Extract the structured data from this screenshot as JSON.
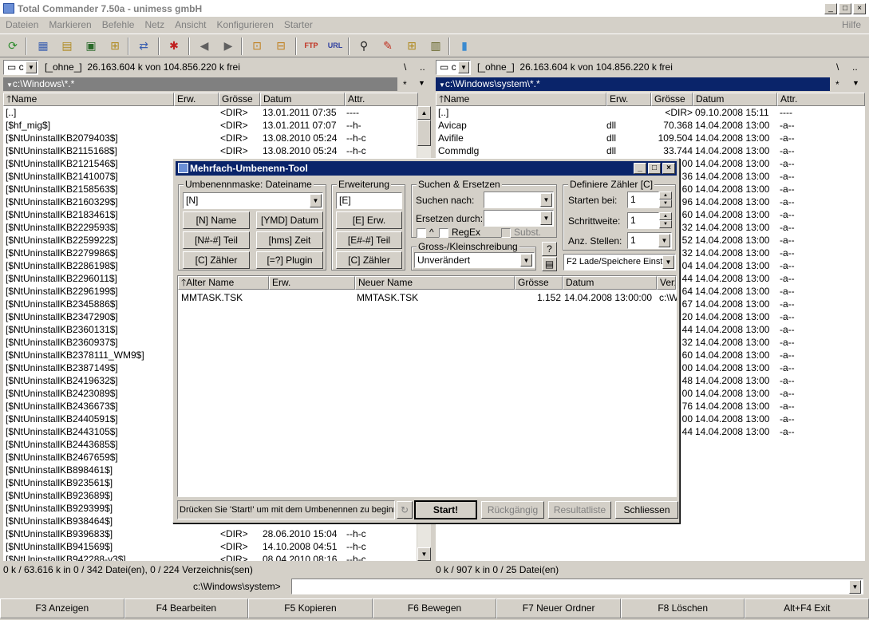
{
  "window": {
    "title": "Total Commander 7.50a - unimess gmbH",
    "min": "_",
    "max": "□",
    "close": "×"
  },
  "menu": {
    "items": [
      "Dateien",
      "Markieren",
      "Befehle",
      "Netz",
      "Ansicht",
      "Konfigurieren",
      "Starter"
    ],
    "help": "Hilfe"
  },
  "left": {
    "drive": "c",
    "volume": "[_ohne_]",
    "free": "26.163.604 k von 104.856.220 k frei",
    "root_btn": "\\",
    "up_btn": "..",
    "path": "c:\\Windows\\*.*",
    "star": "*",
    "columns": [
      "Name",
      "Erw.",
      "Grösse",
      "Datum",
      "Attr."
    ],
    "rows": [
      [
        "[..]",
        "",
        "<DIR>",
        "13.01.2011 07:35",
        "----"
      ],
      [
        "[$hf_mig$]",
        "",
        "<DIR>",
        "13.01.2011 07:07",
        "--h-"
      ],
      [
        "[$NtUninstallKB2079403$]",
        "",
        "<DIR>",
        "13.08.2010 05:24",
        "--h-c"
      ],
      [
        "[$NtUninstallKB2115168$]",
        "",
        "<DIR>",
        "13.08.2010 05:24",
        "--h-c"
      ],
      [
        "[$NtUninstallKB2121546$]",
        "",
        "",
        "",
        ""
      ],
      [
        "[$NtUninstallKB2141007$]",
        "",
        "",
        "",
        ""
      ],
      [
        "[$NtUninstallKB2158563$]",
        "",
        "",
        "",
        ""
      ],
      [
        "[$NtUninstallKB2160329$]",
        "",
        "",
        "",
        ""
      ],
      [
        "[$NtUninstallKB2183461$]",
        "",
        "",
        "",
        ""
      ],
      [
        "[$NtUninstallKB2229593$]",
        "",
        "",
        "",
        ""
      ],
      [
        "[$NtUninstallKB2259922$]",
        "",
        "",
        "",
        ""
      ],
      [
        "[$NtUninstallKB2279986$]",
        "",
        "",
        "",
        ""
      ],
      [
        "[$NtUninstallKB2286198$]",
        "",
        "",
        "",
        ""
      ],
      [
        "[$NtUninstallKB2296011$]",
        "",
        "",
        "",
        ""
      ],
      [
        "[$NtUninstallKB2296199$]",
        "",
        "",
        "",
        ""
      ],
      [
        "[$NtUninstallKB2345886$]",
        "",
        "",
        "",
        ""
      ],
      [
        "[$NtUninstallKB2347290$]",
        "",
        "",
        "",
        ""
      ],
      [
        "[$NtUninstallKB2360131$]",
        "",
        "",
        "",
        ""
      ],
      [
        "[$NtUninstallKB2360937$]",
        "",
        "",
        "",
        ""
      ],
      [
        "[$NtUninstallKB2378111_WM9$]",
        "",
        "",
        "",
        ""
      ],
      [
        "[$NtUninstallKB2387149$]",
        "",
        "",
        "",
        ""
      ],
      [
        "[$NtUninstallKB2419632$]",
        "",
        "",
        "",
        ""
      ],
      [
        "[$NtUninstallKB2423089$]",
        "",
        "",
        "",
        ""
      ],
      [
        "[$NtUninstallKB2436673$]",
        "",
        "",
        "",
        ""
      ],
      [
        "[$NtUninstallKB2440591$]",
        "",
        "",
        "",
        ""
      ],
      [
        "[$NtUninstallKB2443105$]",
        "",
        "",
        "",
        ""
      ],
      [
        "[$NtUninstallKB2443685$]",
        "",
        "",
        "",
        ""
      ],
      [
        "[$NtUninstallKB2467659$]",
        "",
        "",
        "",
        ""
      ],
      [
        "[$NtUninstallKB898461$]",
        "",
        "",
        "",
        ""
      ],
      [
        "[$NtUninstallKB923561$]",
        "",
        "",
        "",
        ""
      ],
      [
        "[$NtUninstallKB923689$]",
        "",
        "",
        "",
        ""
      ],
      [
        "[$NtUninstallKB929399$]",
        "",
        "",
        "",
        ""
      ],
      [
        "[$NtUninstallKB938464$]",
        "",
        "<DIR>",
        "",
        "--h-c"
      ],
      [
        "[$NtUninstallKB939683$]",
        "",
        "<DIR>",
        "28.06.2010 15:04",
        "--h-c"
      ],
      [
        "[$NtUninstallKB941569$]",
        "",
        "<DIR>",
        "14.10.2008 04:51",
        "--h-c"
      ],
      [
        "[$NtUninstallKB942288-v3$]",
        "",
        "<DIR>",
        "08.04.2010 08:16",
        "--h-c"
      ]
    ],
    "status": "0 k / 63.616 k in 0 / 342 Datei(en), 0 / 224 Verzeichnis(sen)"
  },
  "right": {
    "drive": "c",
    "volume": "[_ohne_]",
    "free": "26.163.604 k von 104.856.220 k frei",
    "root_btn": "\\",
    "up_btn": "..",
    "path": "c:\\Windows\\system\\*.*",
    "star": "*",
    "columns": [
      "Name",
      "Erw.",
      "Grösse",
      "Datum",
      "Attr."
    ],
    "rows": [
      [
        "[..]",
        "",
        "<DIR>",
        "09.10.2008 15:11",
        "----"
      ],
      [
        "Avicap",
        "dll",
        "70.368",
        "14.04.2008 13:00",
        "-a--"
      ],
      [
        "Avifile",
        "dll",
        "109.504",
        "14.04.2008 13:00",
        "-a--"
      ],
      [
        "Commdlg",
        "dll",
        "33.744",
        "14.04.2008 13:00",
        "-a--"
      ],
      [
        "",
        "",
        "00",
        "14.04.2008 13:00",
        "-a--"
      ],
      [
        "",
        "",
        "36",
        "14.04.2008 13:00",
        "-a--"
      ],
      [
        "",
        "",
        "60",
        "14.04.2008 13:00",
        "-a--"
      ],
      [
        "",
        "",
        "96",
        "14.04.2008 13:00",
        "-a--"
      ],
      [
        "",
        "",
        "60",
        "14.04.2008 13:00",
        "-a--"
      ],
      [
        "",
        "",
        "32",
        "14.04.2008 13:00",
        "-a--"
      ],
      [
        "",
        "",
        "52",
        "14.04.2008 13:00",
        "-a--"
      ],
      [
        "",
        "",
        "32",
        "14.04.2008 13:00",
        "-a--"
      ],
      [
        "",
        "",
        "04",
        "14.04.2008 13:00",
        "-a--"
      ],
      [
        "",
        "",
        "44",
        "14.04.2008 13:00",
        "-a--"
      ],
      [
        "",
        "",
        "64",
        "14.04.2008 13:00",
        "-a--"
      ],
      [
        "",
        "",
        "67",
        "14.04.2008 13:00",
        "-a--"
      ],
      [
        "",
        "",
        "20",
        "14.04.2008 13:00",
        "-a--"
      ],
      [
        "",
        "",
        "44",
        "14.04.2008 13:00",
        "-a--"
      ],
      [
        "",
        "",
        "32",
        "14.04.2008 13:00",
        "-a--"
      ],
      [
        "",
        "",
        "60",
        "14.04.2008 13:00",
        "-a--"
      ],
      [
        "",
        "",
        "00",
        "14.04.2008 13:00",
        "-a--"
      ],
      [
        "",
        "",
        "48",
        "14.04.2008 13:00",
        "-a--"
      ],
      [
        "",
        "",
        "00",
        "14.04.2008 13:00",
        "-a--"
      ],
      [
        "",
        "",
        "76",
        "14.04.2008 13:00",
        "-a--"
      ],
      [
        "",
        "",
        "00",
        "14.04.2008 13:00",
        "-a--"
      ],
      [
        "",
        "",
        "44",
        "14.04.2008 13:00",
        "-a--"
      ]
    ],
    "status": "0 k / 907 k in 0 / 25 Datei(en)"
  },
  "cmdline": {
    "path": "c:\\Windows\\system>",
    "value": ""
  },
  "fkeys": [
    "F3 Anzeigen",
    "F4 Bearbeiten",
    "F5 Kopieren",
    "F6 Bewegen",
    "F7 Neuer Ordner",
    "F8 Löschen",
    "Alt+F4 Exit"
  ],
  "dialog": {
    "title": "Mehrfach-Umbenenn-Tool",
    "mask_group": "Umbenennmaske: Dateiname",
    "mask_value": "[N]",
    "mask_buttons": [
      "[N]  Name",
      "[YMD]  Datum",
      "[N#-#]  Teil",
      "[hms]  Zeit",
      "[C]  Zähler",
      "[=?]  Plugin"
    ],
    "ext_group": "Erweiterung",
    "ext_value": "[E]",
    "ext_buttons": [
      "[E]  Erw.",
      "[E#-#]  Teil",
      "[C]  Zähler"
    ],
    "search_group": "Suchen & Ersetzen",
    "search_label": "Suchen nach:",
    "replace_label": "Ersetzen durch:",
    "search_value": "",
    "replace_value": "",
    "caret_label": "^",
    "regex_label": "RegEx",
    "subst_label": "Subst.",
    "case_group": "Gross-/Kleinschreibung",
    "case_value": "Unverändert",
    "help_btn": "?",
    "counter_group": "Definiere Zähler [C]",
    "start_label": "Starten bei:",
    "start_value": "1",
    "step_label": "Schrittweite:",
    "step_value": "1",
    "digits_label": "Anz. Stellen:",
    "digits_value": "1",
    "settings_value": "F2 Lade/Speichere Einst",
    "list_columns": [
      "Alter Name",
      "Erw.",
      "Neuer Name",
      "Grösse",
      "Datum",
      "Verz"
    ],
    "list_rows": [
      [
        "MMTASK.TSK",
        "",
        "MMTASK.TSK",
        "1.152",
        "14.04.2008 13:00:00",
        "c:\\W"
      ]
    ],
    "hint": "Drücken Sie 'Start!' um mit dem Umbenennen zu beginnen",
    "start_btn": "Start!",
    "undo_btn": "Rückgängig",
    "result_btn": "Resultatliste",
    "close_btn": "Schliessen"
  }
}
